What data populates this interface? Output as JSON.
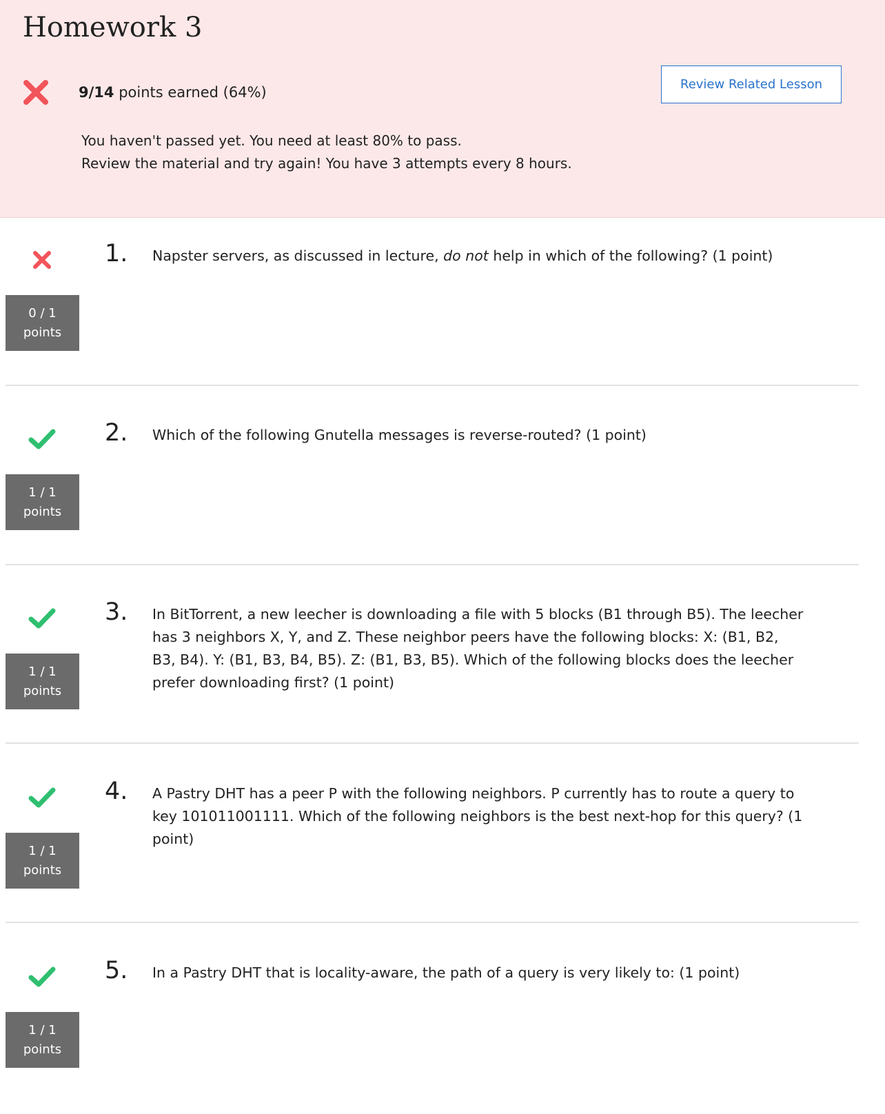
{
  "header": {
    "title": "Homework 3",
    "score_earned": "9/14",
    "score_suffix": " points earned (64%)",
    "review_button_label": "Review Related Lesson",
    "message_line1": "You haven't passed yet. You need at least 80% to pass.",
    "message_line2": "Review the material and try again!  You have 3 attempts every 8 hours.",
    "status_icon": "fail-x-icon"
  },
  "colors": {
    "header_bg": "#fde8e9",
    "fail_red": "#f2545b",
    "pass_green": "#2fbf71",
    "link_blue": "#2a73cc",
    "points_badge_bg": "#6b6b6b"
  },
  "questions": [
    {
      "number": "1.",
      "status": "incorrect",
      "status_icon": "x-icon",
      "points_score": "0 / 1",
      "points_label": "points",
      "text_before": "Napster servers, as discussed in lecture, ",
      "text_emphasis": "do not",
      "text_after": " help in which of the following? (1 point)"
    },
    {
      "number": "2.",
      "status": "correct",
      "status_icon": "checkmark-icon",
      "points_score": "1 / 1",
      "points_label": "points",
      "text": "Which of the following Gnutella messages is reverse-routed? (1 point)"
    },
    {
      "number": "3.",
      "status": "correct",
      "status_icon": "checkmark-icon",
      "points_score": "1 / 1",
      "points_label": "points",
      "text": "In BitTorrent, a new leecher is downloading a file with 5 blocks (B1 through B5). The leecher has 3 neighbors X, Y, and Z. These neighbor peers have the following blocks: X: (B1, B2, B3, B4). Y: (B1, B3, B4, B5). Z: (B1, B3, B5). Which of the following blocks does the leecher prefer downloading first? (1 point)"
    },
    {
      "number": "4.",
      "status": "correct",
      "status_icon": "checkmark-icon",
      "points_score": "1 / 1",
      "points_label": "points",
      "text": "A Pastry DHT has a peer P with the following neighbors. P currently has to route a query to key 101011001111. Which of the following neighbors is the best next-hop for this query? (1 point)"
    },
    {
      "number": "5.",
      "status": "correct",
      "status_icon": "checkmark-icon",
      "points_score": "1 / 1",
      "points_label": "points",
      "text": "In a Pastry DHT that is locality-aware, the path of a query is very likely to: (1 point)"
    }
  ]
}
